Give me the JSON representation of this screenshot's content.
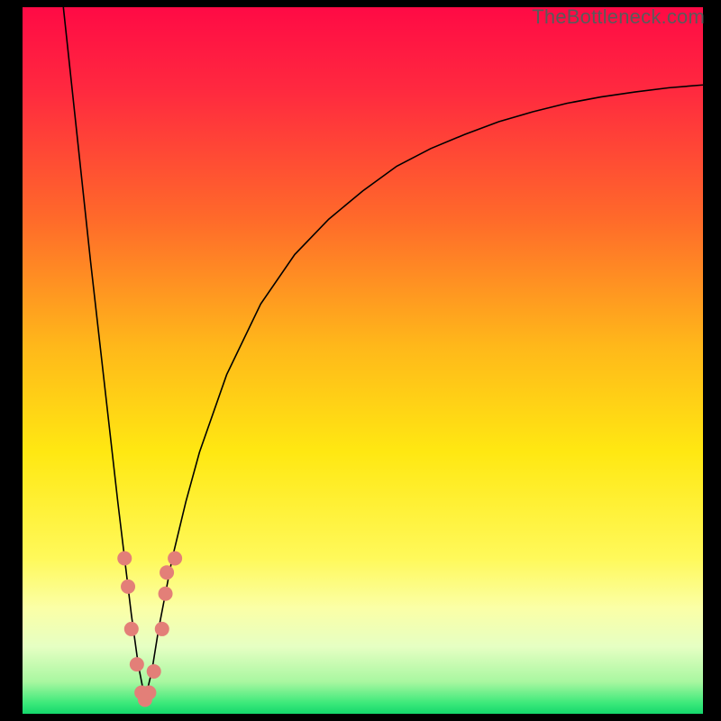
{
  "watermark": {
    "text": "TheBottleneck.com"
  },
  "chart_data": {
    "type": "line",
    "title": "",
    "xlabel": "",
    "ylabel": "",
    "xlim": [
      0,
      100
    ],
    "ylim": [
      0,
      100
    ],
    "grid": false,
    "notes": "V-shaped bottleneck curve on a vertical red→orange→yellow→pale-green→green gradient background. Minimum of the curve is ≈2 at x≈18. Salmon dots cluster near the trough.",
    "background_gradient": {
      "direction": "vertical",
      "stops": [
        {
          "pos": 0.0,
          "color": "#ff0a45"
        },
        {
          "pos": 0.12,
          "color": "#ff2a3f"
        },
        {
          "pos": 0.3,
          "color": "#ff6a2a"
        },
        {
          "pos": 0.48,
          "color": "#ffb81a"
        },
        {
          "pos": 0.63,
          "color": "#ffe812"
        },
        {
          "pos": 0.78,
          "color": "#fff95a"
        },
        {
          "pos": 0.85,
          "color": "#fbffa6"
        },
        {
          "pos": 0.905,
          "color": "#e6ffc3"
        },
        {
          "pos": 0.955,
          "color": "#a8f7a0"
        },
        {
          "pos": 0.985,
          "color": "#3ce97a"
        },
        {
          "pos": 1.0,
          "color": "#14d76c"
        }
      ]
    },
    "series": [
      {
        "name": "bottleneck-curve",
        "color": "#000000",
        "x": [
          6,
          8,
          10,
          12,
          14,
          15,
          16,
          17,
          18,
          19,
          20,
          21,
          22,
          24,
          26,
          30,
          35,
          40,
          45,
          50,
          55,
          60,
          65,
          70,
          75,
          80,
          85,
          90,
          95,
          100
        ],
        "y": [
          100,
          82,
          64,
          47,
          30,
          22,
          14,
          7,
          2,
          6,
          12,
          17,
          22,
          30,
          37,
          48,
          58,
          65,
          70,
          74,
          77.5,
          80,
          82,
          83.8,
          85.2,
          86.4,
          87.3,
          88,
          88.6,
          89
        ]
      }
    ],
    "dots": {
      "name": "trough-markers",
      "color": "#e37f78",
      "radius_px": 8,
      "points": [
        {
          "x": 15.0,
          "y": 22
        },
        {
          "x": 15.5,
          "y": 18
        },
        {
          "x": 16.0,
          "y": 12
        },
        {
          "x": 16.8,
          "y": 7
        },
        {
          "x": 17.5,
          "y": 3
        },
        {
          "x": 18.0,
          "y": 2
        },
        {
          "x": 18.6,
          "y": 3
        },
        {
          "x": 19.3,
          "y": 6
        },
        {
          "x": 20.5,
          "y": 12
        },
        {
          "x": 21.0,
          "y": 17
        },
        {
          "x": 21.2,
          "y": 20
        },
        {
          "x": 22.4,
          "y": 22
        }
      ]
    }
  }
}
